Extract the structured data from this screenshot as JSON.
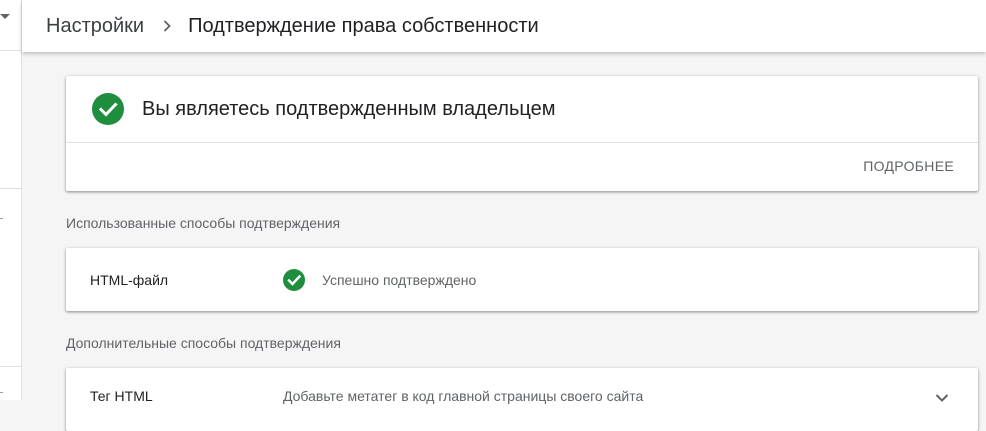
{
  "breadcrumb": {
    "root": "Настройки",
    "current": "Подтверждение права собственности"
  },
  "owner_card": {
    "title": "Вы являетесь подтвержденным владельцем",
    "more_link": "ПОДРОБНЕЕ"
  },
  "used_methods": {
    "label": "Использованные способы подтверждения",
    "items": [
      {
        "name": "HTML-файл",
        "status": "Успешно подтверждено"
      }
    ]
  },
  "extra_methods": {
    "label": "Дополнительные способы подтверждения",
    "items": [
      {
        "name": "Тег HTML",
        "description": "Добавьте метатег в код главной страницы своего сайта"
      }
    ]
  },
  "colors": {
    "success_green": "#1e8e3e",
    "text_primary": "#202124",
    "text_secondary": "#5f6368",
    "background": "#f5f5f5"
  },
  "icons": {
    "breadcrumb_separator": "chevron-right-icon",
    "verified": "check-circle-icon",
    "expand": "chevron-down-icon",
    "sidebar_dropdown": "caret-down-icon"
  }
}
